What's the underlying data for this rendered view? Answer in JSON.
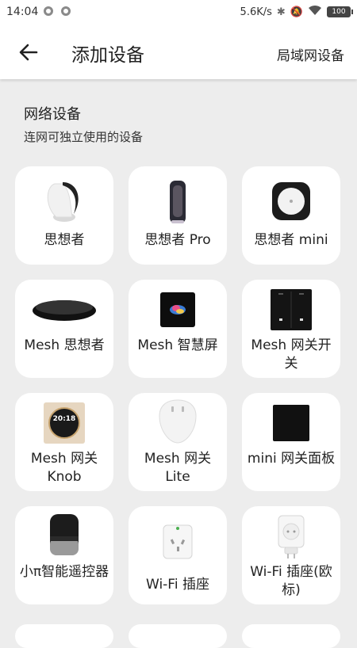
{
  "status_bar": {
    "time": "14:04",
    "network_speed": "5.6K/s",
    "battery": "100"
  },
  "app_bar": {
    "title": "添加设备",
    "lan_devices_label": "局域网设备"
  },
  "section": {
    "title": "网络设备",
    "subtitle": "连网可独立使用的设备"
  },
  "devices": [
    {
      "label": "思想者",
      "icon": "thinker-speaker-icon"
    },
    {
      "label": "思想者 Pro",
      "icon": "thinker-pro-icon"
    },
    {
      "label": "思想者 mini",
      "icon": "thinker-mini-icon"
    },
    {
      "label": "Mesh 思想者",
      "icon": "mesh-thinker-icon"
    },
    {
      "label": "Mesh 智慧屏",
      "icon": "mesh-smart-screen-icon"
    },
    {
      "label": "Mesh 网关开关",
      "icon": "mesh-gateway-switch-icon"
    },
    {
      "label": "Mesh 网关 Knob",
      "icon": "mesh-gateway-knob-icon",
      "knob_time": "20:18"
    },
    {
      "label": "Mesh 网关 Lite",
      "icon": "mesh-gateway-lite-icon"
    },
    {
      "label": "mini 网关面板",
      "icon": "mini-gateway-panel-icon"
    },
    {
      "label": "小π智能遥控器",
      "icon": "xiaopi-remote-icon"
    },
    {
      "label": "Wi-Fi 插座",
      "icon": "wifi-socket-icon"
    },
    {
      "label": "Wi-Fi 插座(欧标)",
      "icon": "wifi-socket-eu-icon"
    }
  ]
}
